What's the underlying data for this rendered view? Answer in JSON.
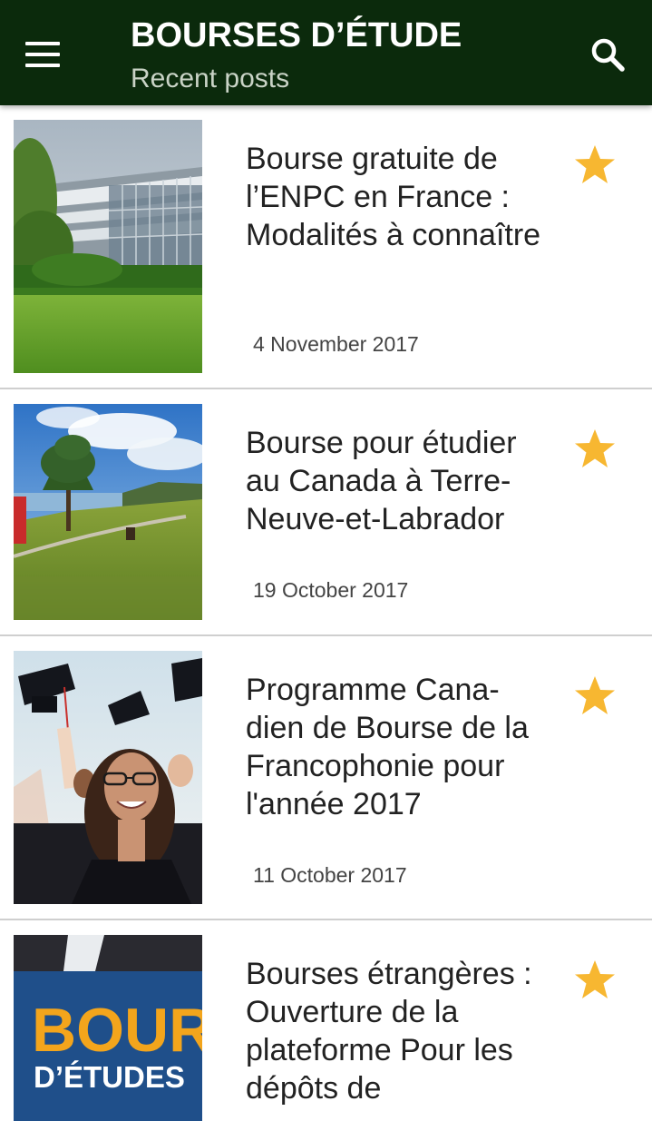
{
  "appbar": {
    "title": "BOURSES D’ÉTUDE",
    "subtitle": "Recent posts",
    "background": "#0b2a0c"
  },
  "icons": {
    "menu": "hamburger-menu-icon",
    "search": "search-icon",
    "favorite": "star-icon"
  },
  "accent": "#f7b731",
  "posts": [
    {
      "title": "Bourse gratuite de l’ENPC en France : Modalités à connaître",
      "date": "4 November 2017",
      "image": "campus building behind green lawn"
    },
    {
      "title": "Bourse pour étudier au Canada à Terre-Neuve-et-Labrador",
      "date": "19 October 2017",
      "image": "coastal grassland with tree and red cabin"
    },
    {
      "title": "Programme Cana-dien de Bourse de la Francophonie pour l'année 2017",
      "date": "11 October 2017",
      "image": "graduates throwing caps"
    },
    {
      "title": "Bourses étrangères : Ouverture de la plateforme Pour les dépôts de",
      "date": "",
      "image": "BOURSES D’ÉTUDES poster",
      "image_text": {
        "line1": "BOUR",
        "line2": "D’ÉTUDES"
      }
    }
  ]
}
